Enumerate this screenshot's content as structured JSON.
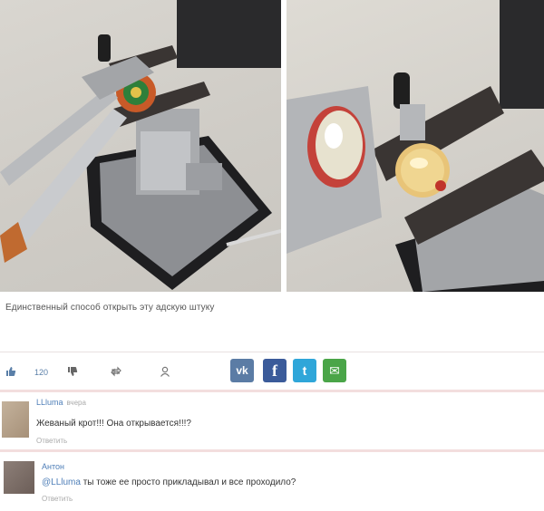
{
  "post": {
    "caption": "Единственный способ открыть эту адскую штуку"
  },
  "actions": {
    "like_count": "120",
    "like_icon": "thumbs-up-icon",
    "dislike_icon": "thumbs-down-icon",
    "repost_icon": "repost-icon",
    "share_icon": "users-icon"
  },
  "social": {
    "vk": "vk",
    "facebook": "f",
    "twitter": "t",
    "mail": "✉"
  },
  "comments": [
    {
      "author": "LLluma",
      "time": "вчера",
      "text": "Жеваный крот!!! Она открывается!!!?",
      "reply": "Ответить"
    },
    {
      "author": "Антон",
      "mention": "@LLluma",
      "text": " ты тоже ее просто прикладывал и все проходило?",
      "reply": "Ответить"
    }
  ],
  "colors": {
    "link": "#4f7fb8",
    "vk": "#5b7ca5",
    "facebook": "#3b5b9a",
    "twitter": "#2fa6d9",
    "mail": "#4aa548",
    "divider": "#f3dede"
  }
}
